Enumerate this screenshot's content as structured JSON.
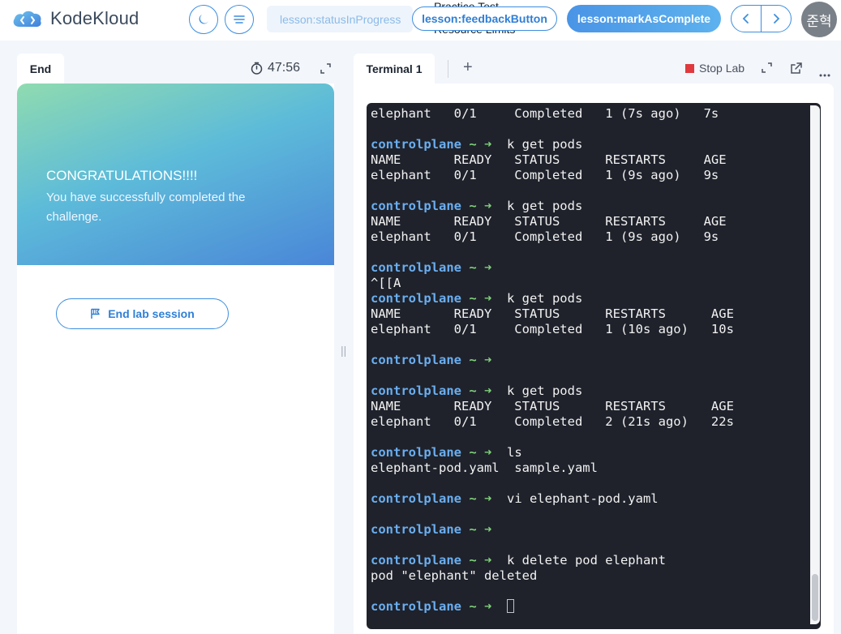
{
  "app": {
    "name": "KodeKloud"
  },
  "topbar": {
    "status_label": "lesson:statusInProgress",
    "overlay_line1": "Practice Test",
    "overlay_line2": "Resource Limits",
    "feedback_label": "lesson:feedbackButton",
    "complete_label": "lesson:markAsComplete",
    "avatar_text": "준혁"
  },
  "left": {
    "tab_label": "End",
    "timer": "47:56",
    "congrats_title": "CONGRATULATIONS!!!!",
    "congrats_body": "You have successfully completed the challenge.",
    "end_lab_label": "End lab session"
  },
  "right": {
    "tab_label": "Terminal 1",
    "add_tab": "+",
    "stop_lab_label": "Stop Lab"
  },
  "terminal": {
    "prompt_host": "controlplane",
    "prompt_rest": " ~ ➜  ",
    "lines": [
      {
        "type": "out",
        "text": "elephant   0/1     Completed   1 (7s ago)   7s"
      },
      {
        "type": "out",
        "text": ""
      },
      {
        "type": "prompt",
        "text": "k get pods"
      },
      {
        "type": "out",
        "text": "NAME       READY   STATUS      RESTARTS     AGE"
      },
      {
        "type": "out",
        "text": "elephant   0/1     Completed   1 (9s ago)   9s"
      },
      {
        "type": "out",
        "text": ""
      },
      {
        "type": "prompt",
        "text": "k get pods"
      },
      {
        "type": "out",
        "text": "NAME       READY   STATUS      RESTARTS     AGE"
      },
      {
        "type": "out",
        "text": "elephant   0/1     Completed   1 (9s ago)   9s"
      },
      {
        "type": "out",
        "text": ""
      },
      {
        "type": "prompt",
        "text": ""
      },
      {
        "type": "out",
        "text": "^[[A"
      },
      {
        "type": "prompt",
        "text": "k get pods"
      },
      {
        "type": "out",
        "text": "NAME       READY   STATUS      RESTARTS      AGE"
      },
      {
        "type": "out",
        "text": "elephant   0/1     Completed   1 (10s ago)   10s"
      },
      {
        "type": "out",
        "text": ""
      },
      {
        "type": "prompt",
        "text": ""
      },
      {
        "type": "out",
        "text": ""
      },
      {
        "type": "prompt",
        "text": "k get pods"
      },
      {
        "type": "out",
        "text": "NAME       READY   STATUS      RESTARTS      AGE"
      },
      {
        "type": "out",
        "text": "elephant   0/1     Completed   2 (21s ago)   22s"
      },
      {
        "type": "out",
        "text": ""
      },
      {
        "type": "prompt",
        "text": "ls"
      },
      {
        "type": "out",
        "text": "elephant-pod.yaml  sample.yaml"
      },
      {
        "type": "out",
        "text": ""
      },
      {
        "type": "prompt",
        "text": "vi elephant-pod.yaml"
      },
      {
        "type": "out",
        "text": ""
      },
      {
        "type": "prompt",
        "text": ""
      },
      {
        "type": "out",
        "text": ""
      },
      {
        "type": "prompt",
        "text": "k delete pod elephant"
      },
      {
        "type": "out",
        "text": "pod \"elephant\" deleted"
      },
      {
        "type": "out",
        "text": ""
      },
      {
        "type": "cursor",
        "text": ""
      }
    ]
  },
  "icons": {
    "theme": "moon-icon",
    "menu": "list-icon",
    "prev": "chevron-left-icon",
    "next": "chevron-right-icon",
    "timer": "stopwatch-icon",
    "expand": "expand-icon",
    "flag": "flag-icon",
    "popout": "external-window-icon",
    "more": "more-horizontal-icon"
  },
  "colors": {
    "accent": "#3d8ee0",
    "terminal_bg": "#1f222b",
    "prompt_host": "#6aaef0",
    "prompt_arrow": "#7fd07a",
    "stop": "#e0393e"
  }
}
